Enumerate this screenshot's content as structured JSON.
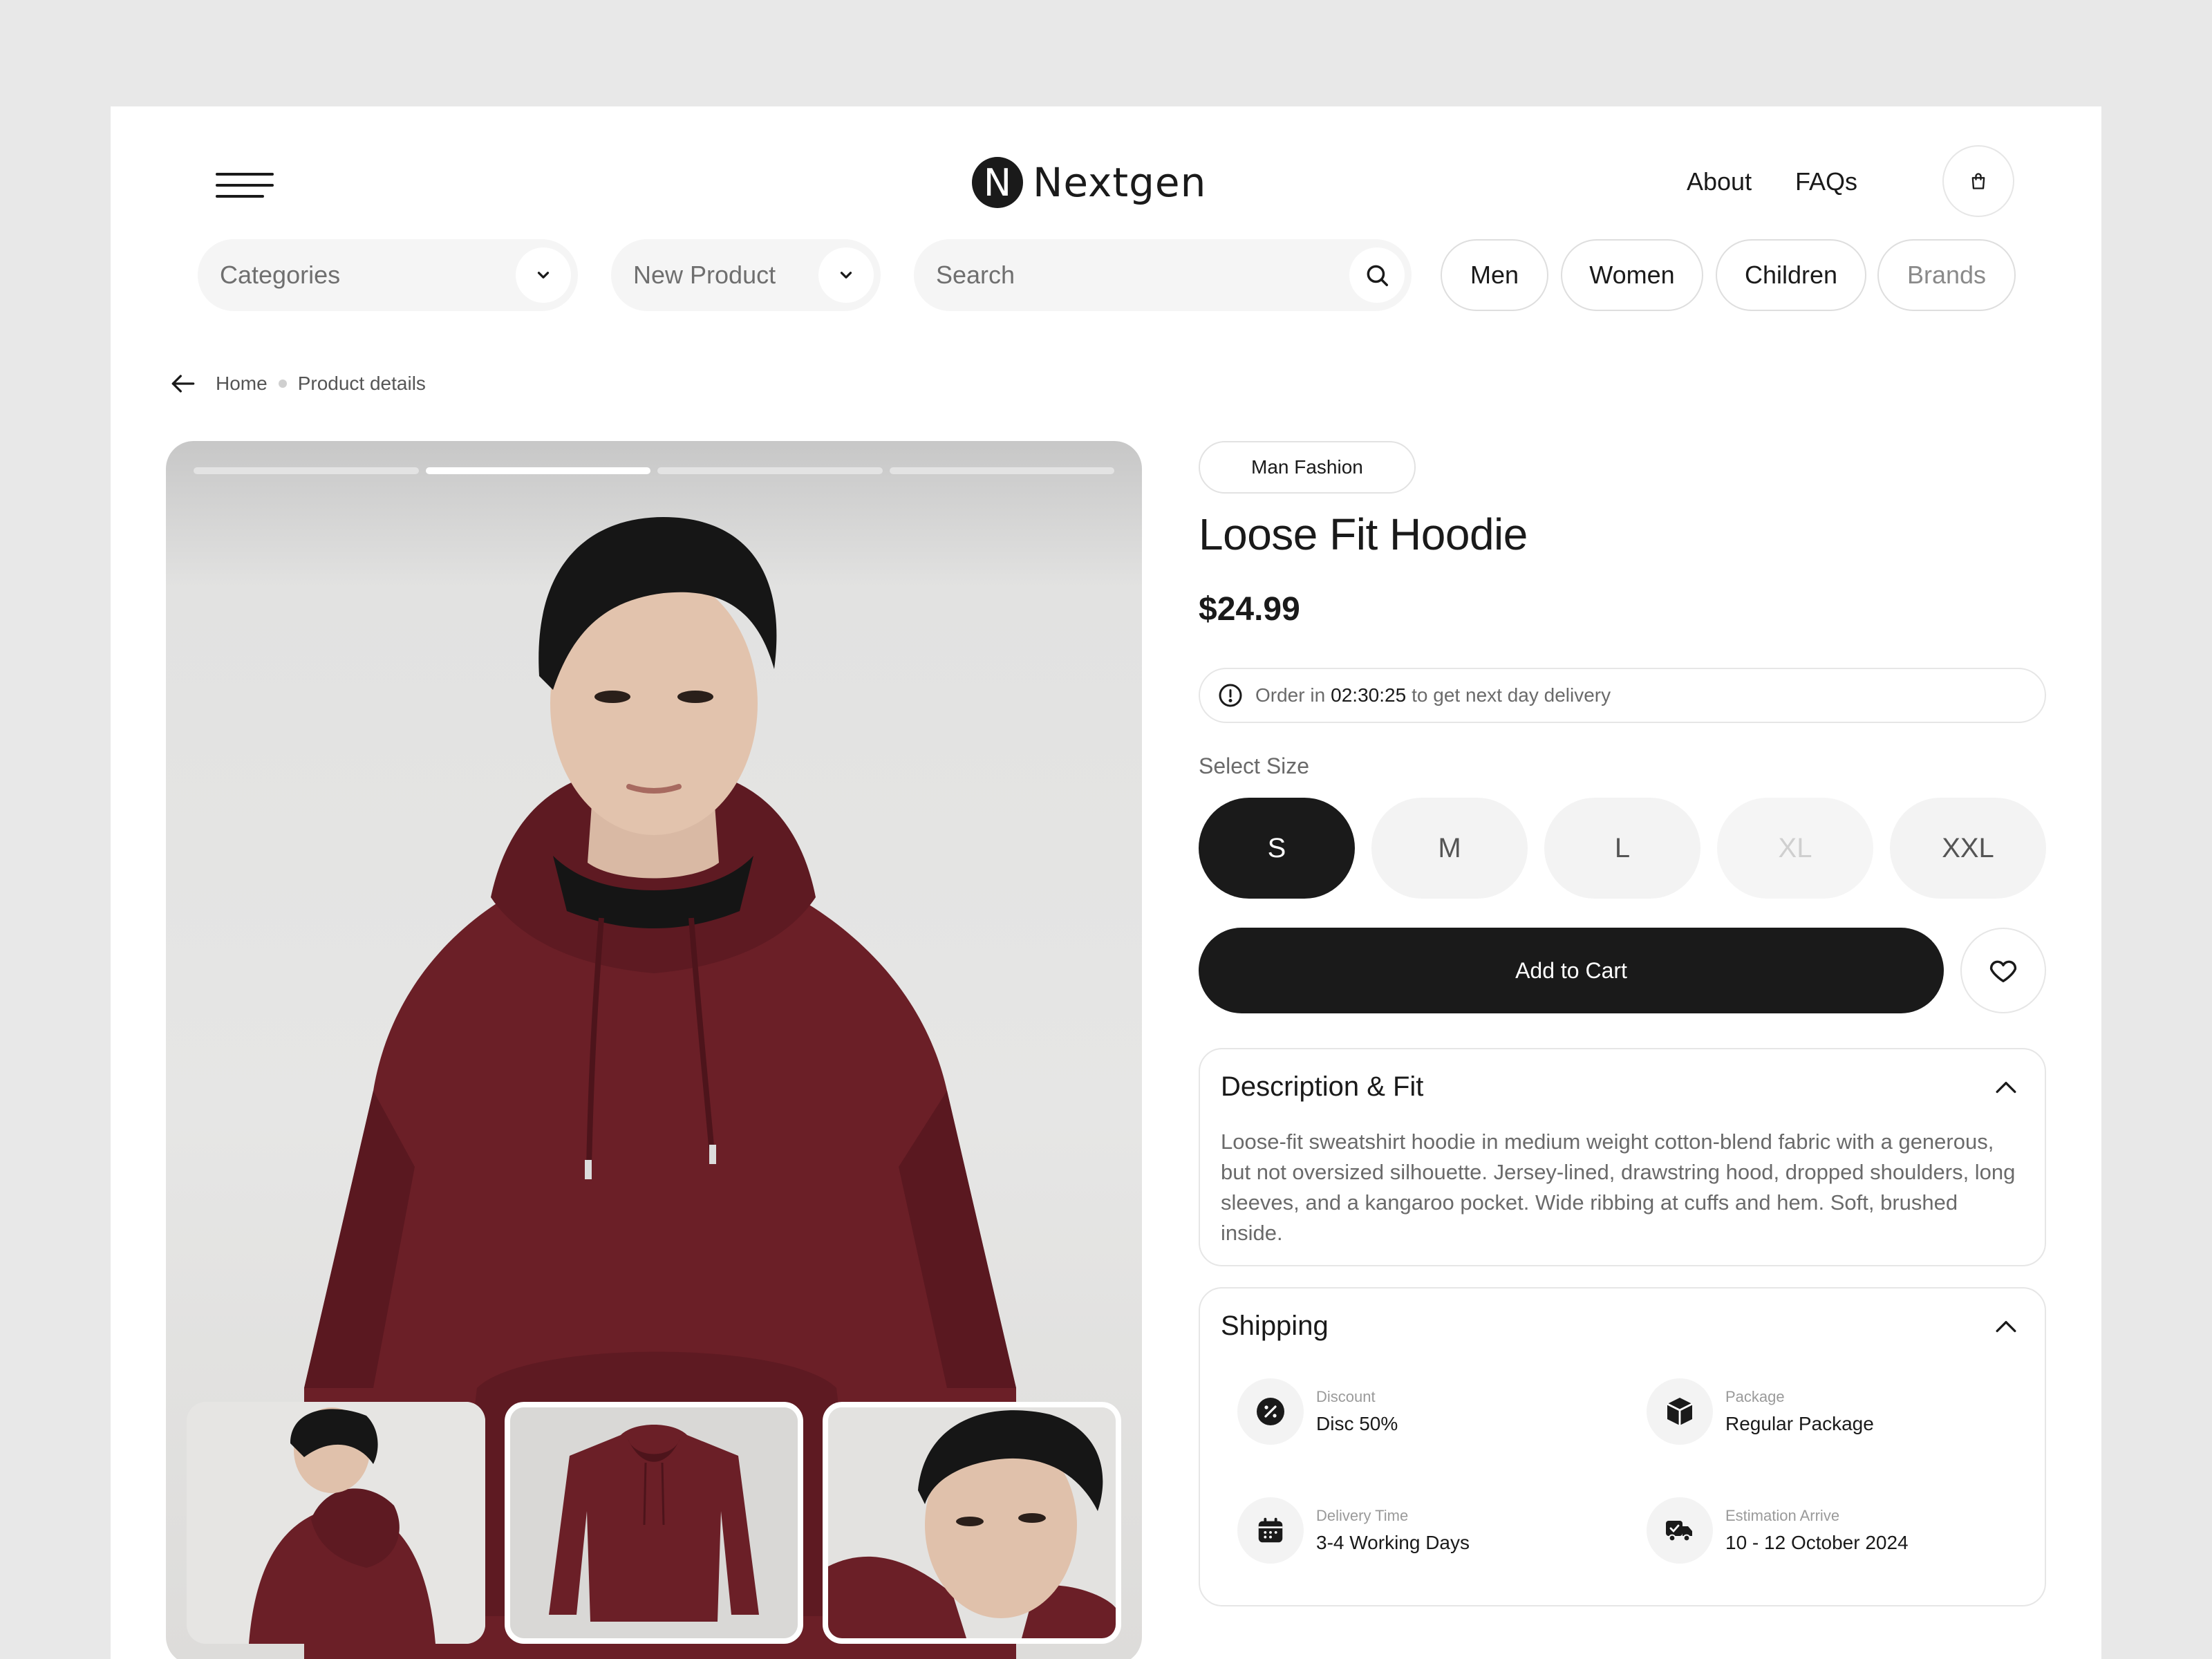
{
  "brand": {
    "logo_letter": "N",
    "name": "Nextgen"
  },
  "nav": {
    "about": "About",
    "faqs": "FAQs"
  },
  "filters": {
    "categories": "Categories",
    "new_product": "New Product",
    "search_placeholder": "Search",
    "genders": [
      "Men",
      "Women",
      "Children",
      "Brands"
    ]
  },
  "breadcrumb": {
    "home": "Home",
    "current": "Product details"
  },
  "gallery": {
    "slides_total": 4,
    "active_slide": 2,
    "selected_thumb": 2
  },
  "product": {
    "tag": "Man Fashion",
    "title": "Loose Fit Hoodie",
    "price": "$24.99",
    "notice_prefix": "Order in",
    "notice_time": "02:30:25",
    "notice_suffix": "to get next day delivery",
    "select_size_label": "Select Size",
    "sizes": [
      {
        "label": "S",
        "state": "selected"
      },
      {
        "label": "M",
        "state": "available"
      },
      {
        "label": "L",
        "state": "available"
      },
      {
        "label": "XL",
        "state": "disabled"
      },
      {
        "label": "XXL",
        "state": "available"
      }
    ],
    "add_to_cart": "Add to Cart"
  },
  "description": {
    "title": "Description & Fit",
    "text": "Loose-fit sweatshirt hoodie in medium weight cotton-blend fabric with a generous, but not oversized silhouette. Jersey-lined, drawstring hood, dropped shoulders, long sleeves, and a kangaroo pocket. Wide ribbing at cuffs and hem. Soft, brushed inside."
  },
  "shipping": {
    "title": "Shipping",
    "items": [
      {
        "label": "Discount",
        "value": "Disc 50%",
        "icon": "discount-icon"
      },
      {
        "label": "Package",
        "value": "Regular Package",
        "icon": "package-icon"
      },
      {
        "label": "Delivery Time",
        "value": "3-4 Working Days",
        "icon": "calendar-icon"
      },
      {
        "label": "Estimation Arrive",
        "value": "10 - 12 October 2024",
        "icon": "truck-icon"
      }
    ]
  },
  "colors": {
    "primary": "#1a1a1a",
    "hoodie": "#6b1f27",
    "surface": "#f5f5f5",
    "background": "#e8e8e8"
  }
}
